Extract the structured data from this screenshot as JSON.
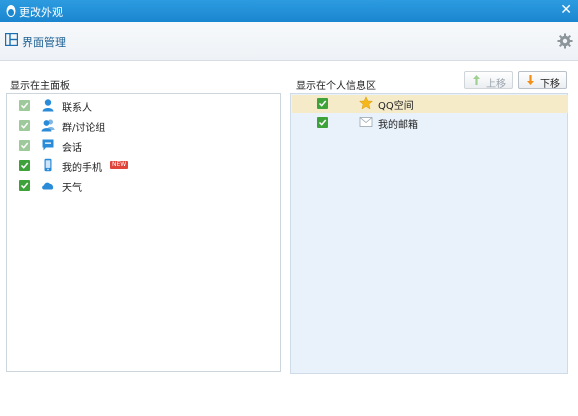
{
  "window": {
    "title": "更改外观"
  },
  "header": {
    "title": "界面管理"
  },
  "left_panel": {
    "label": "显示在主面板",
    "items": [
      {
        "label": "联系人",
        "checked": true,
        "enabled": false,
        "icon": "contact-icon"
      },
      {
        "label": "群/讨论组",
        "checked": true,
        "enabled": false,
        "icon": "group-icon"
      },
      {
        "label": "会话",
        "checked": true,
        "enabled": false,
        "icon": "chat-icon"
      },
      {
        "label": "我的手机",
        "checked": true,
        "enabled": true,
        "icon": "phone-icon",
        "badge": "NEW"
      },
      {
        "label": "天气",
        "checked": true,
        "enabled": true,
        "icon": "weather-icon"
      }
    ]
  },
  "right_panel": {
    "label": "显示在个人信息区",
    "move_up": "上移",
    "move_down": "下移",
    "items": [
      {
        "label": "QQ空间",
        "checked": true,
        "selected": true,
        "icon": "star-icon"
      },
      {
        "label": "我的邮箱",
        "checked": true,
        "selected": false,
        "icon": "mail-icon"
      }
    ]
  },
  "colors": {
    "titlebar": "#1a86cf",
    "accent": "#3ea23a",
    "selected_row": "#f5ebc9"
  }
}
